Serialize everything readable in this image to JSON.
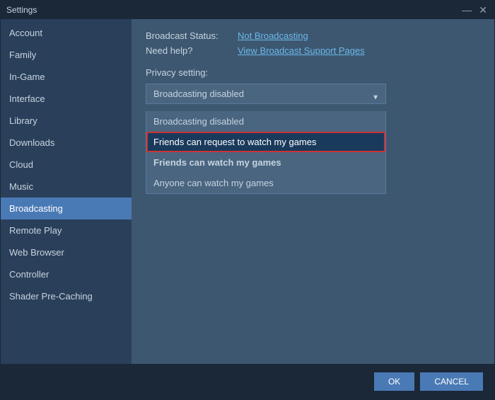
{
  "window": {
    "title": "Settings",
    "min_button": "—",
    "close_button": "✕"
  },
  "sidebar": {
    "items": [
      {
        "id": "account",
        "label": "Account",
        "active": false
      },
      {
        "id": "family",
        "label": "Family",
        "active": false
      },
      {
        "id": "in-game",
        "label": "In-Game",
        "active": false
      },
      {
        "id": "interface",
        "label": "Interface",
        "active": false
      },
      {
        "id": "library",
        "label": "Library",
        "active": false
      },
      {
        "id": "downloads",
        "label": "Downloads",
        "active": false
      },
      {
        "id": "cloud",
        "label": "Cloud",
        "active": false
      },
      {
        "id": "music",
        "label": "Music",
        "active": false
      },
      {
        "id": "broadcasting",
        "label": "Broadcasting",
        "active": true
      },
      {
        "id": "remote-play",
        "label": "Remote Play",
        "active": false
      },
      {
        "id": "web-browser",
        "label": "Web Browser",
        "active": false
      },
      {
        "id": "controller",
        "label": "Controller",
        "active": false
      },
      {
        "id": "shader-pre-caching",
        "label": "Shader Pre-Caching",
        "active": false
      }
    ]
  },
  "content": {
    "broadcast_status_label": "Broadcast Status:",
    "broadcast_status_value": "Not Broadcasting",
    "need_help_label": "Need help?",
    "need_help_link": "View Broadcast Support Pages",
    "privacy_setting_label": "Privacy setting:",
    "dropdown": {
      "selected": "Broadcasting disabled",
      "options": [
        {
          "id": "broadcasting-disabled",
          "label": "Broadcasting disabled"
        },
        {
          "id": "friends-request",
          "label": "Friends can request to watch my games",
          "highlighted": true
        },
        {
          "id": "friends-watch",
          "label": "Friends can watch my games",
          "bold": true
        },
        {
          "id": "anyone-watch",
          "label": "Anyone can watch my games"
        }
      ]
    }
  },
  "footer": {
    "ok_label": "OK",
    "cancel_label": "CANCEL"
  }
}
